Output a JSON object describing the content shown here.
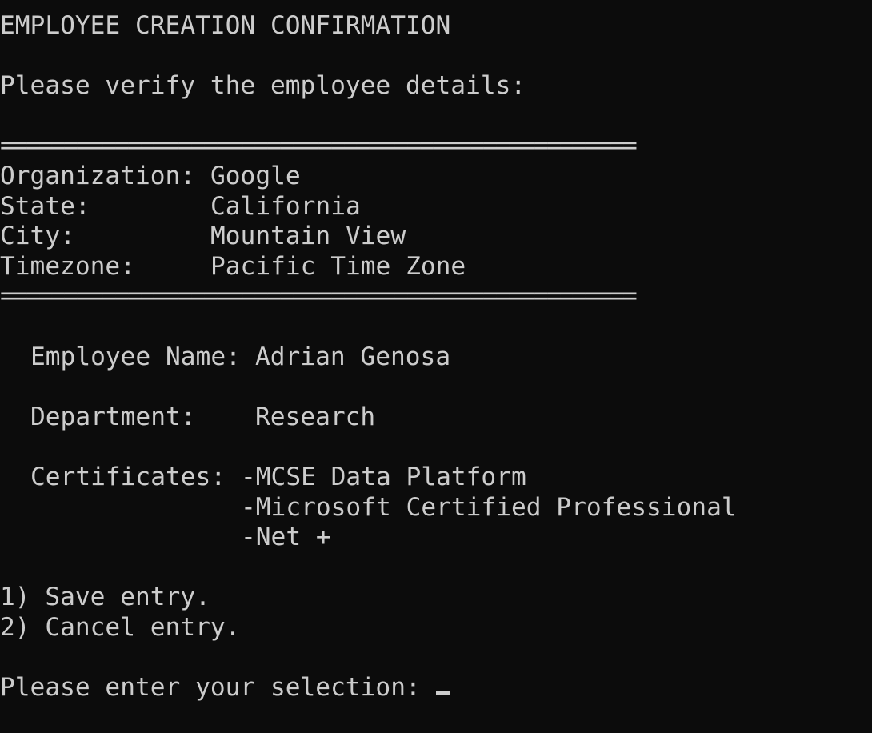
{
  "header": {
    "title": "EMPLOYEE CREATION CONFIRMATION",
    "prompt": "Please verify the employee details:"
  },
  "separator": "==================================================",
  "location": [
    {
      "label": "Organization:",
      "value": "Google"
    },
    {
      "label": "State:",
      "value": "California"
    },
    {
      "label": "City:",
      "value": "Mountain View"
    },
    {
      "label": "Timezone:",
      "value": "Pacific Time Zone"
    }
  ],
  "employee": {
    "name_label": "Employee Name:",
    "name_value": "Adrian Genosa",
    "department_label": "Department:",
    "department_value": "Research",
    "certificates_label": "Certificates:",
    "certificates": [
      "-MCSE Data Platform",
      "-Microsoft Certified Professional",
      "-Net +"
    ]
  },
  "menu": [
    "1) Save entry.",
    "2) Cancel entry."
  ],
  "input": {
    "prompt": "Please enter your selection: ",
    "value": ""
  }
}
